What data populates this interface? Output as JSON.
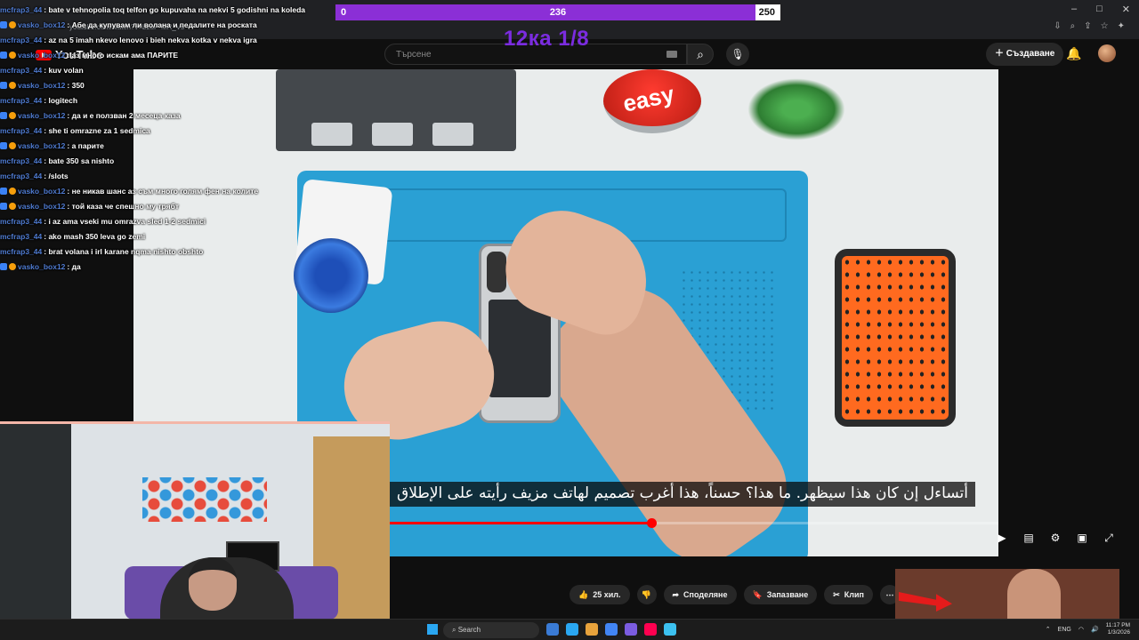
{
  "browser": {
    "url": "youtube.com/watch?v=bzuP-MR_Vs",
    "window_controls": [
      "–",
      "□",
      "✕"
    ]
  },
  "youtube": {
    "logo_text": "YouTube",
    "search_placeholder": "Търсене",
    "create_label": "Създаване"
  },
  "overlay": {
    "goal_min": "0",
    "goal_current": "236",
    "goal_max": "250",
    "goal_fraction": 0.944,
    "goal_title": "12ка 1/8",
    "goal_color": "#8b2fd6"
  },
  "chat": [
    {
      "user": "mcfrap3_44",
      "msg": ": bate v tehnopolia toq telfon go kupuvaha na nekvi 5 godishni na koleda",
      "badges": false
    },
    {
      "user": "vasko_box12",
      "msg": ": Абе да купувам ли волана и педалите на роската",
      "badges": true
    },
    {
      "user": "mcfrap3_44",
      "msg": ": az na 5 imah nkevo lenovo i bieh nekva kotka v nekva igra",
      "badges": false
    },
    {
      "user": "vasko_box12",
      "msg": ": аз много искам ама ПАРИТЕ",
      "badges": true
    },
    {
      "user": "mcfrap3_44",
      "msg": ": kuv volan",
      "badges": false
    },
    {
      "user": "vasko_box12",
      "msg": ": 350",
      "badges": true
    },
    {
      "user": "mcfrap3_44",
      "msg": ": logitech",
      "badges": false
    },
    {
      "user": "vasko_box12",
      "msg": ": да и е ползван 2 месеца каза",
      "badges": true
    },
    {
      "user": "mcfrap3_44",
      "msg": ": she ti omrazne za 1 sedmica",
      "badges": false
    },
    {
      "user": "vasko_box12",
      "msg": ": а парите",
      "badges": true
    },
    {
      "user": "mcfrap3_44",
      "msg": ": bate 350 sa nishto",
      "badges": false
    },
    {
      "user": "mcfrap3_44",
      "msg": ": /slots",
      "badges": false
    },
    {
      "user": "vasko_box12",
      "msg": ": не никав шанс аз съм много голям фен на колите",
      "badges": true
    },
    {
      "user": "vasko_box12",
      "msg": ": той каза че спешно му трябт",
      "badges": true
    },
    {
      "user": "mcfrap3_44",
      "msg": ": i az ama vseki mu omrazva sled 1-2 sedmici",
      "badges": false
    },
    {
      "user": "mcfrap3_44",
      "msg": ": ako mash 350 leva go zemi",
      "badges": false
    },
    {
      "user": "mcfrap3_44",
      "msg": ": brat volana i irl karane nqma nishto obshto",
      "badges": false
    },
    {
      "user": "vasko_box12",
      "msg": ": да",
      "badges": true
    }
  ],
  "video": {
    "easy_label": "easy",
    "subtitle": "أتساءل إن كان هذا سيظهر. ما هذا؟ حسناً، هذا أغرب تصميم لهاتف مزيف رأيته على الإطلاق",
    "progress": 0.43,
    "controls": [
      {
        "name": "play-icon",
        "glyph": "▶"
      },
      {
        "name": "subtitles-icon",
        "glyph": "▤"
      },
      {
        "name": "settings-icon",
        "glyph": "⚙"
      },
      {
        "name": "miniplayer-icon",
        "glyph": "▣"
      },
      {
        "name": "fullscreen-icon",
        "glyph": "⤢"
      }
    ]
  },
  "actions": {
    "like_count": "25 хил.",
    "share": "Споделяне",
    "save": "Запазване",
    "clip": "Клип",
    "more": "⋯"
  },
  "taskbar": {
    "search": "Search",
    "lang": "ENG",
    "time": "11:17 PM",
    "date": "1/3/2026"
  }
}
